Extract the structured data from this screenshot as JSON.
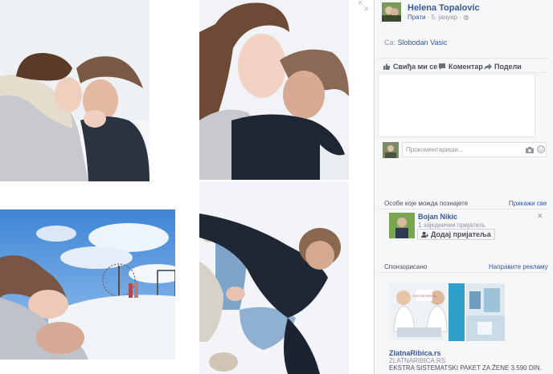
{
  "post": {
    "author": "Helena Topalovic",
    "follow_label": "Прати",
    "date": "5. јануар",
    "with_label": "Са:",
    "with_name": "Slobodan Vasic"
  },
  "actions": {
    "like": "Свиђа ми се",
    "comment": "Коментар",
    "share": "Подели"
  },
  "comment": {
    "placeholder": "Прокоментариши..."
  },
  "people": {
    "heading": "Особе које можда познајете",
    "see_all": "Прикажи све",
    "name": "Bojan Nikic",
    "mutual": "1 заједнички пријатељ",
    "add_friend": "Додај пријатеља"
  },
  "sponsored": {
    "heading": "Спонзорисано",
    "create_ad": "Направите рекламу",
    "ad_logo": "ZLATNA RIBICA",
    "ad_title": "ZlatnaRibica.rs",
    "ad_domain": "ZLATNARIBICA.RS",
    "ad_text": "EKSTRA SISTEMATSKI PAKET ZA ŽENE 3.590 DIN."
  },
  "icons": {
    "expand": "expand-icon",
    "globe": "globe-icon",
    "like": "thumbs-up-icon",
    "comment": "speech-bubble-icon",
    "share": "share-arrow-icon",
    "camera": "camera-icon",
    "emoji": "smiley-icon",
    "close": "close-icon",
    "add_friend": "add-person-icon"
  },
  "colors": {
    "link": "#365899",
    "sidebar_bg": "#f6f7f9",
    "sky": "#4f90d8"
  }
}
